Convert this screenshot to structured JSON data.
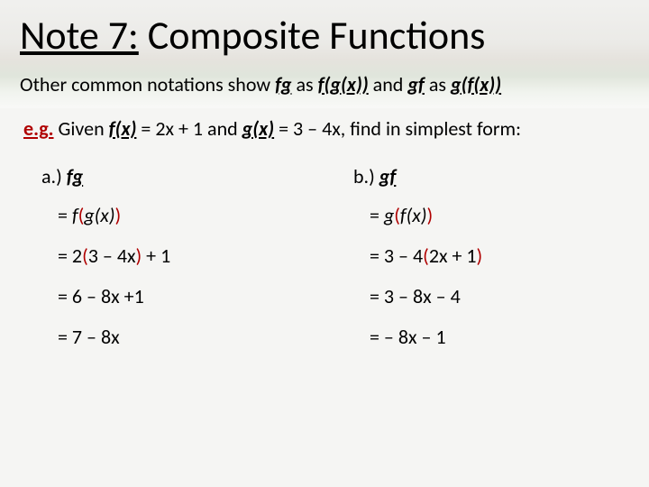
{
  "title_prefix": "Note 7:",
  "title_rest": "  Composite Functions",
  "intro": {
    "t1": "Other common notations show ",
    "fg": "fg",
    "t2": " as ",
    "fgx": "f(g(x))",
    "t3": " and ",
    "gf": "gf",
    "t4": " as ",
    "gfx": "g(f(x))"
  },
  "eg": {
    "label": "e.g.",
    "t1": "  Given ",
    "fx": "f(x)",
    "t2": " = 2x + 1 and ",
    "gx": "g(x)",
    "t3": " = 3 – 4x, find in simplest form:"
  },
  "colA": {
    "head_prefix": "a.)  ",
    "head_fn": "fg",
    "s1_eq": "= ",
    "s1_f": "f",
    "s1_open": "(",
    "s1_g": "g(x)",
    "s1_close": ")",
    "s2_pre": "= 2",
    "s2_open": "(",
    "s2_in": "3 – 4x",
    "s2_close": ")",
    "s2_post": " + 1",
    "s3": "= 6 – 8x +1",
    "s4": "= 7 – 8x"
  },
  "colB": {
    "head_prefix": "b.)  ",
    "head_fn": "gf",
    "s1_eq": "= ",
    "s1_g": "g",
    "s1_open": "(",
    "s1_f": "f(x)",
    "s1_close": ")",
    "s2_pre": "= 3 – 4",
    "s2_open": "(",
    "s2_in": "2x + 1",
    "s2_close": ")",
    "s3": "= 3 – 8x – 4",
    "s4": "= – 8x – 1"
  }
}
